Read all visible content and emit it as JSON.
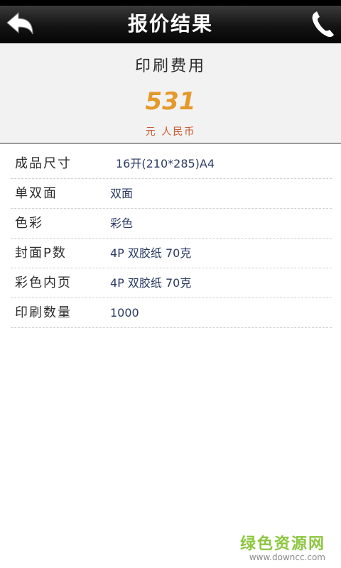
{
  "header": {
    "title": "报价结果",
    "back_icon": "back-arrow-icon",
    "phone_icon": "phone-icon"
  },
  "summary": {
    "label": "印刷费用",
    "price": "531",
    "currency": "元 人民币",
    "price_color": "#e4992a"
  },
  "details": [
    {
      "label": "成品尺寸",
      "value": "16开(210*285)A4"
    },
    {
      "label": "单双面",
      "value": "双面"
    },
    {
      "label": "色彩",
      "value": "彩色"
    },
    {
      "label": "封面P数",
      "value": "4P 双胶纸 70克"
    },
    {
      "label": "彩色内页",
      "value": "4P 双胶纸 70克"
    },
    {
      "label": "印刷数量",
      "value": "1000"
    }
  ],
  "watermark": {
    "main": "绿色资源网",
    "sub": "www.downcc.com"
  }
}
